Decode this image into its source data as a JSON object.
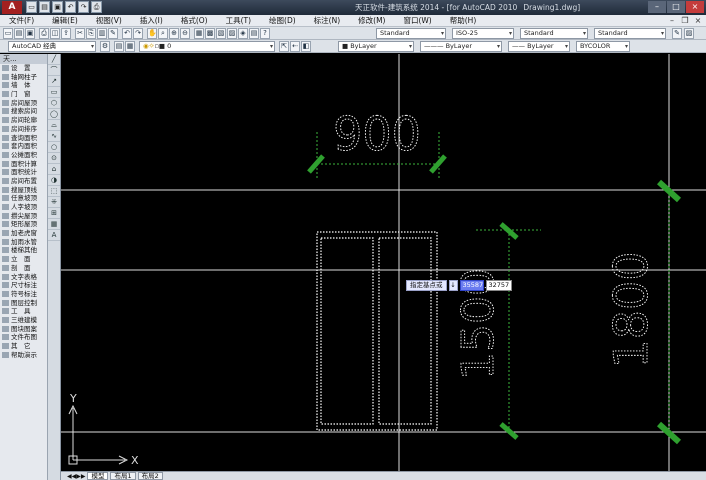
{
  "titlebar": {
    "logo": "A",
    "app_title": "天正软件-建筑系统 2014 - [for AutoCAD 2010",
    "drawing": "Drawing1.dwg]",
    "qat_icons": [
      "new-icon",
      "open-icon",
      "save-icon",
      "undo-icon",
      "redo-icon",
      "print-icon"
    ]
  },
  "menu": [
    "文件(F)",
    "编辑(E)",
    "视图(V)",
    "插入(I)",
    "格式(O)",
    "工具(T)",
    "绘图(D)",
    "标注(N)",
    "修改(M)",
    "窗口(W)",
    "帮助(H)"
  ],
  "toolbar": {
    "style1": "Standard",
    "style2": "ISO-25",
    "style3": "Standard",
    "style4": "Standard",
    "workspace": "AutoCAD 经典",
    "layer": "0",
    "color": "ByLayer",
    "linetype": "ByLayer",
    "lineweight": "ByLayer",
    "plotstyle": "BYCOLOR"
  },
  "palette": {
    "title": "天...",
    "items": [
      "设　置",
      "轴网柱子",
      "墙　体",
      "门　窗",
      "房间屋顶",
      "搜索房间",
      "房间轮廓",
      "房间排序",
      "查询面积",
      "套内面积",
      "公摊面积",
      "面积计算",
      "面积统计",
      "房间布置",
      "搜屋顶线",
      "任意坡顶",
      "人字坡顶",
      "攒尖屋顶",
      "矩形屋顶",
      "加老虎窗",
      "加雨水管",
      "楼梯其他",
      "立　面",
      "剖　面",
      "文字表格",
      "尺寸标注",
      "符号标注",
      "图层控制",
      "工　具",
      "三维建模",
      "图块图案",
      "文件布图",
      "其　它",
      "帮助演示"
    ]
  },
  "tools": [
    "╱",
    "⌒",
    "↗",
    "▭",
    "⬡",
    "◯",
    "⌓",
    "∿",
    "○",
    "⊙",
    "⌂",
    "◑",
    "⬚",
    "⁜",
    "⊞",
    "▦",
    "A"
  ],
  "drawing": {
    "dim_top": "900",
    "dim_mid": "1500",
    "dim_right": "1800",
    "ucs_y": "Y",
    "ucs_x": "X"
  },
  "dynamic_input": {
    "prompt": "指定基点或",
    "icon": "↓",
    "x_value": "35587",
    "y_value": "32757"
  },
  "tabs": [
    "模型",
    "布局1",
    "布局2"
  ]
}
